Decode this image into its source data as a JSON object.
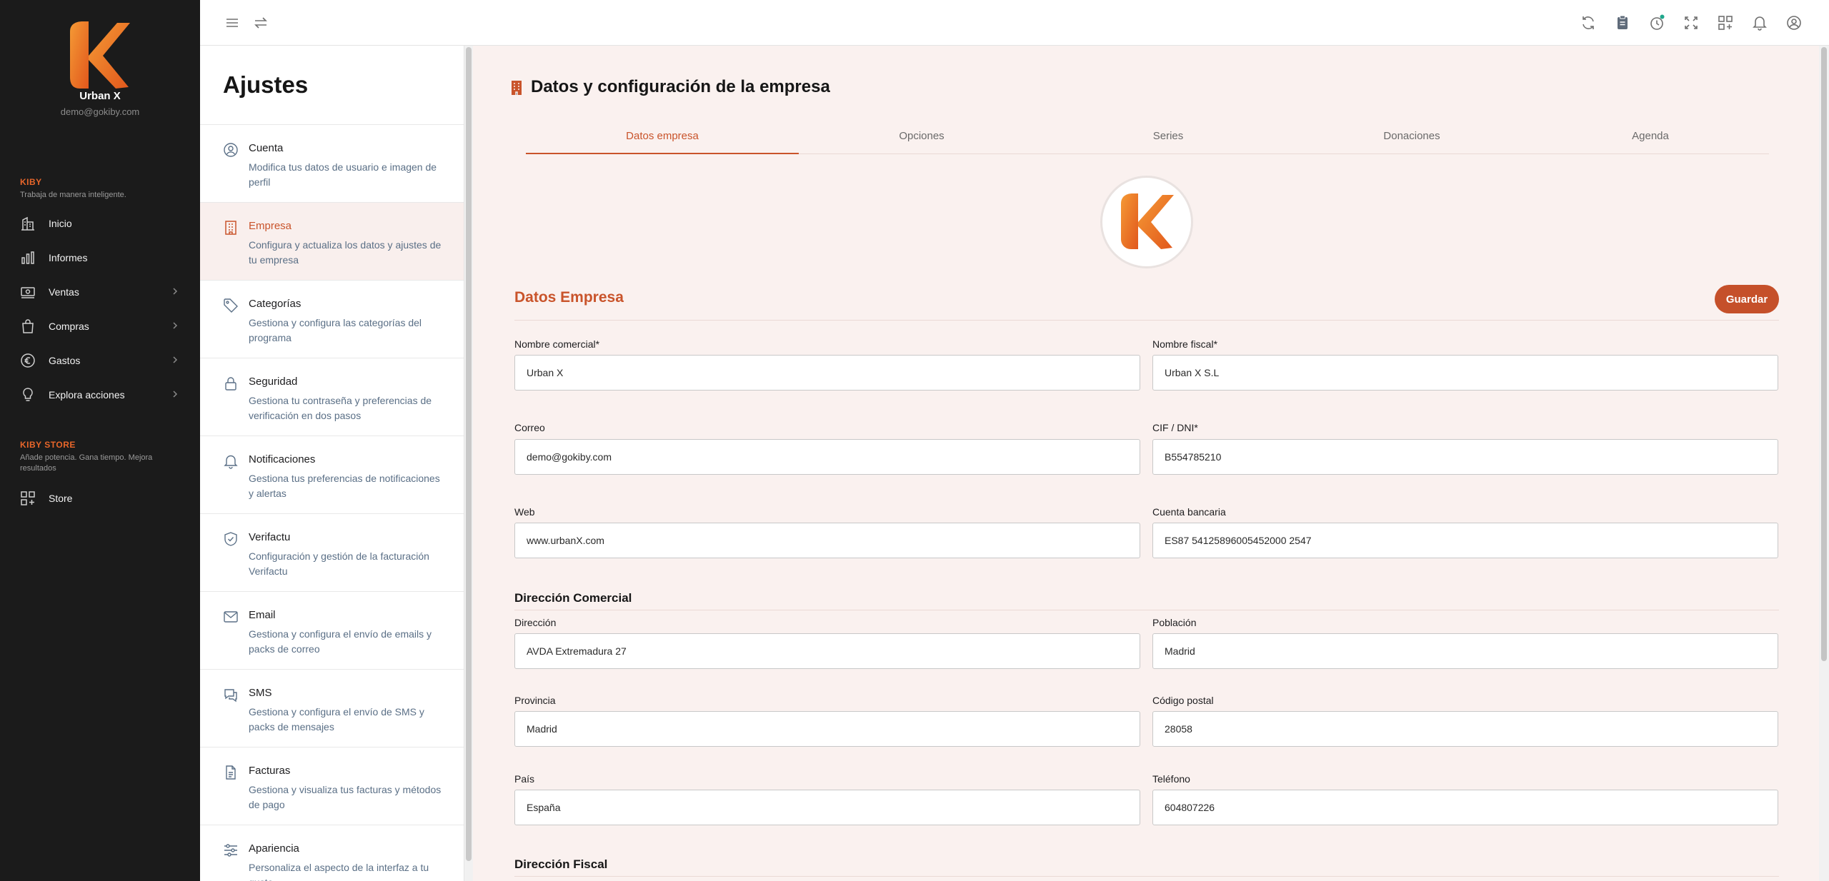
{
  "sidebar": {
    "user_name": "Urban X",
    "user_email": "demo@gokiby.com",
    "section_kiby": {
      "title": "KIBY",
      "subtitle": "Trabaja de manera inteligente."
    },
    "items": [
      {
        "label": "Inicio",
        "icon": "building-chart-icon"
      },
      {
        "label": "Informes",
        "icon": "bar-chart-icon"
      },
      {
        "label": "Ventas",
        "icon": "cash-icon"
      },
      {
        "label": "Compras",
        "icon": "shopping-bag-icon"
      },
      {
        "label": "Gastos",
        "icon": "euro-icon"
      },
      {
        "label": "Explora acciones",
        "icon": "lightbulb-icon"
      }
    ],
    "section_store": {
      "title": "KIBY STORE",
      "subtitle": "Añade potencia. Gana tiempo. Mejora resultados"
    },
    "store_item": {
      "label": "Store",
      "icon": "grid-plus-icon"
    }
  },
  "topbar": {
    "left_icons": [
      "menu-icon",
      "swap-icon"
    ],
    "right_icons": [
      "refresh-icon",
      "clipboard-icon",
      "timer-icon",
      "fullscreen-icon",
      "apps-add-icon",
      "bell-icon",
      "user-circle-icon"
    ]
  },
  "settings": {
    "title": "Ajustes",
    "items": [
      {
        "title": "Cuenta",
        "desc": "Modifica tus datos de usuario e imagen de perfil",
        "icon": "user-circle-icon"
      },
      {
        "title": "Empresa",
        "desc": "Configura y actualiza los datos y ajustes de tu empresa",
        "icon": "building-icon"
      },
      {
        "title": "Categorías",
        "desc": "Gestiona y configura las categorías del programa",
        "icon": "tag-icon"
      },
      {
        "title": "Seguridad",
        "desc": "Gestiona tu contraseña y preferencias de verificación en dos pasos",
        "icon": "lock-icon"
      },
      {
        "title": "Notificaciones",
        "desc": "Gestiona tus preferencias de notificaciones y alertas",
        "icon": "bell-icon"
      },
      {
        "title": "Verifactu",
        "desc": "Configuración y gestión de la facturación Verifactu",
        "icon": "shield-check-icon"
      },
      {
        "title": "Email",
        "desc": "Gestiona y configura el envío de emails y packs de correo",
        "icon": "mail-icon"
      },
      {
        "title": "SMS",
        "desc": "Gestiona y configura el envío de SMS y packs de mensajes",
        "icon": "chat-icon"
      },
      {
        "title": "Facturas",
        "desc": "Gestiona y visualiza tus facturas y métodos de pago",
        "icon": "document-icon"
      },
      {
        "title": "Apariencia",
        "desc": "Personaliza el aspecto de la interfaz a tu gusto",
        "icon": "sliders-icon"
      }
    ]
  },
  "main": {
    "title": "Datos y configuración de la empresa",
    "tabs": [
      "Datos empresa",
      "Opciones",
      "Series",
      "Donaciones",
      "Agenda"
    ],
    "section_title": "Datos Empresa",
    "save_label": "Guardar",
    "fields": {
      "nombre_comercial": {
        "label": "Nombre comercial*",
        "value": "Urban X"
      },
      "nombre_fiscal": {
        "label": "Nombre fiscal*",
        "value": "Urban X S.L"
      },
      "correo": {
        "label": "Correo",
        "value": "demo@gokiby.com"
      },
      "cif": {
        "label": "CIF / DNI*",
        "value": "B554785210"
      },
      "web": {
        "label": "Web",
        "value": "www.urbanX.com"
      },
      "cuenta": {
        "label": "Cuenta bancaria",
        "value": "ES87 54125896005452000 2547"
      }
    },
    "direccion_comercial": {
      "title": "Dirección Comercial",
      "direccion": {
        "label": "Dirección",
        "value": "AVDA Extremadura 27"
      },
      "poblacion": {
        "label": "Población",
        "value": "Madrid"
      },
      "provincia": {
        "label": "Provincia",
        "value": "Madrid"
      },
      "codigo_postal": {
        "label": "Código postal",
        "value": "28058"
      },
      "pais": {
        "label": "País",
        "value": "España"
      },
      "telefono": {
        "label": "Teléfono",
        "value": "604807226"
      }
    },
    "direccion_fiscal": {
      "title": "Dirección Fiscal"
    }
  },
  "colors": {
    "accent": "#c9542b",
    "brand_orange": "#e8662a",
    "sidebar_bg": "#1b1b1b",
    "main_bg": "#faf1ef"
  }
}
